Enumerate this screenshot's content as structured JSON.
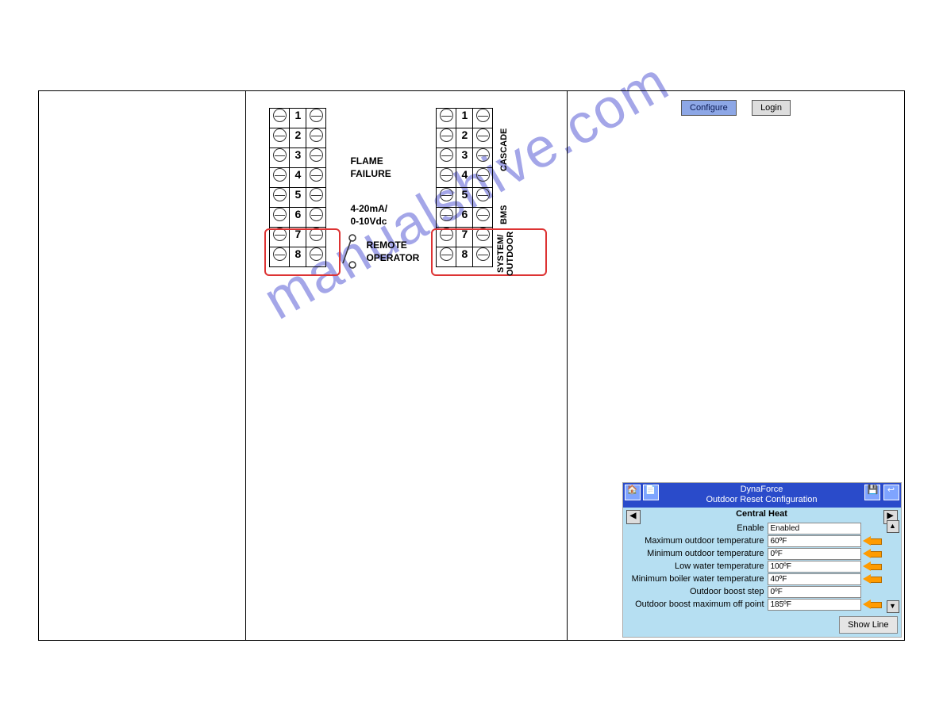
{
  "watermark": "manualshive.com",
  "diagram": {
    "left_block": {
      "rows": [
        1,
        2,
        3,
        4,
        5,
        6,
        7,
        8
      ]
    },
    "right_block": {
      "rows": [
        1,
        2,
        3,
        4,
        5,
        6,
        7,
        8
      ]
    },
    "flame_failure": "FLAME\nFAILURE",
    "signal": "4-20mA/\n0-10Vdc",
    "remote_operator": "REMOTE\nOPERATOR",
    "labels_right": {
      "cascade": "CASCADE",
      "bms": "BMS",
      "system_outdoor": "SYSTEM/\nOUTDOOR"
    }
  },
  "buttons": {
    "configure": "Configure",
    "login": "Login"
  },
  "panel": {
    "title1": "DynaForce",
    "title2": "Outdoor Reset Configuration",
    "section": "Central Heat",
    "rows": [
      {
        "label": "Enable",
        "value": "Enabled",
        "arrow": false
      },
      {
        "label": "Maximum outdoor temperature",
        "value": "60ºF",
        "arrow": true
      },
      {
        "label": "Minimum outdoor temperature",
        "value": "0ºF",
        "arrow": true
      },
      {
        "label": "Low water temperature",
        "value": "100ºF",
        "arrow": true
      },
      {
        "label": "Minimum boiler water temperature",
        "value": "40ºF",
        "arrow": true
      },
      {
        "label": "Outdoor boost step",
        "value": "0ºF",
        "arrow": false
      },
      {
        "label": "Outdoor boost maximum off point",
        "value": "185ºF",
        "arrow": true
      }
    ],
    "show_line": "Show Line"
  }
}
